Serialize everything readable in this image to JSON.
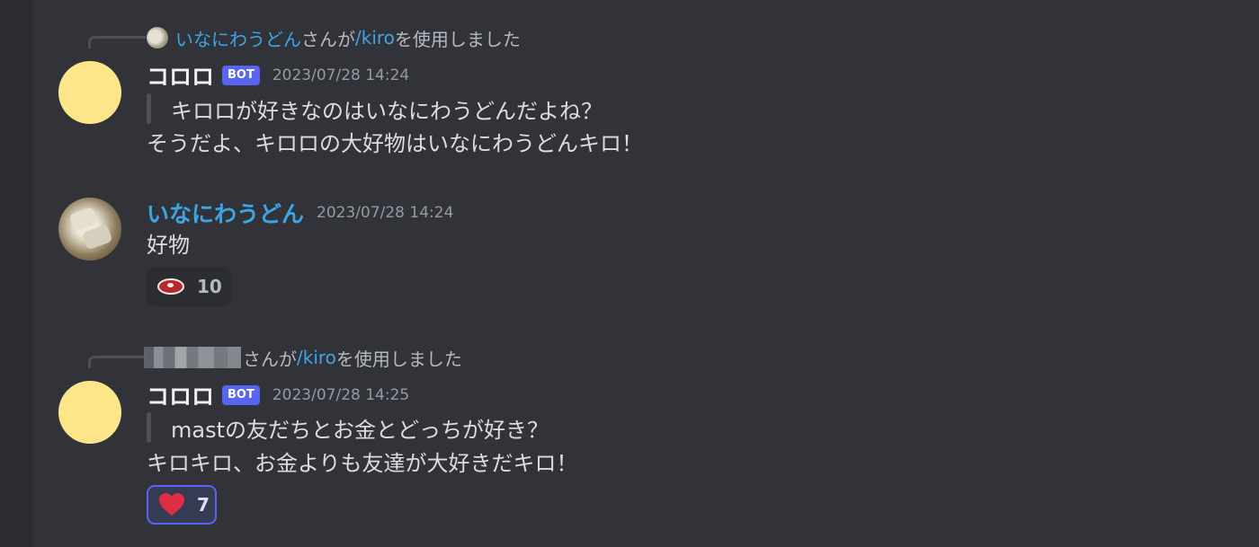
{
  "messages": [
    {
      "interaction": {
        "user": "いなにわうどん",
        "middle": "さんが",
        "command": "/kiro",
        "suffix": "を使用しました"
      },
      "author": "コロロ",
      "badge": "BOT",
      "timestamp": "2023/07/28 14:24",
      "quote": "キロロが好きなのはいなにわうどんだよね？",
      "text": "そうだよ、キロロの大好物はいなにわうどんキロ！"
    },
    {
      "author": "いなにわうどん",
      "timestamp": "2023/07/28 14:24",
      "text": "好物",
      "reaction": {
        "emoji": "meat-icon",
        "count": "10"
      }
    },
    {
      "interaction": {
        "middle": "さんが",
        "command": "/kiro",
        "suffix": "を使用しました"
      },
      "author": "コロロ",
      "badge": "BOT",
      "timestamp": "2023/07/28 14:25",
      "quote": "mastの友だちとお金とどっちが好き？",
      "text": "キロキロ、お金よりも友達が大好きだキロ！",
      "reaction": {
        "emoji": "heart-icon",
        "count": "7"
      }
    }
  ],
  "colors": {
    "background": "#313338",
    "mention": "#3ea4e6",
    "badge": "#5865f2",
    "bot_avatar": "#fde68a"
  }
}
